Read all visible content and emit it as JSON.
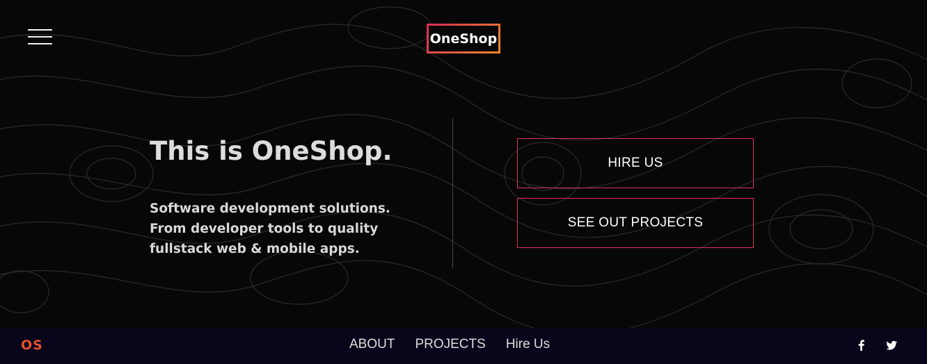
{
  "header": {
    "menu_icon": "hamburger-menu-icon",
    "logo_text": "OneShop",
    "logo_border_colors": [
      "#d62b55",
      "#f08a2a"
    ]
  },
  "hero": {
    "title": "This is OneShop.",
    "subtitle_lines": [
      "Software development solutions.",
      "From developer tools to quality",
      "fullstack web & mobile apps."
    ]
  },
  "actions": {
    "hire_label": "HIRE US",
    "projects_label": "SEE OUT PROJECTS",
    "border_color": "#e0335d"
  },
  "footer": {
    "brand": "OS",
    "brand_color": "#e8502f",
    "nav": [
      "ABOUT",
      "PROJECTS",
      "Hire Us"
    ],
    "social_icons": [
      "facebook-icon",
      "twitter-icon"
    ]
  }
}
